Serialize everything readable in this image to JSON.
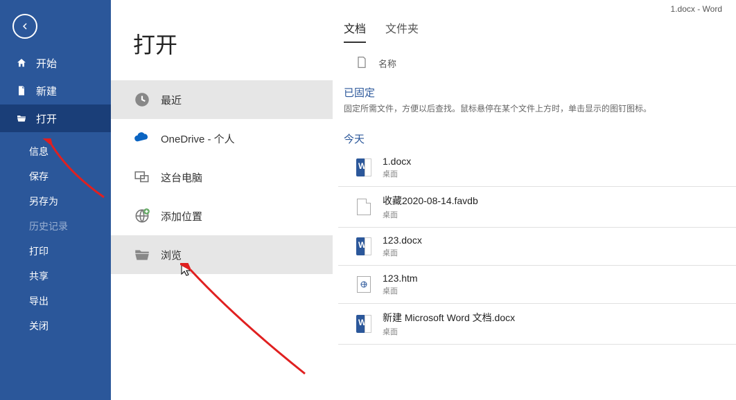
{
  "titlebar": "1.docx  -  Word",
  "sidebar": {
    "items": [
      {
        "label": "开始"
      },
      {
        "label": "新建"
      },
      {
        "label": "打开"
      },
      {
        "label": "信息"
      },
      {
        "label": "保存"
      },
      {
        "label": "另存为"
      },
      {
        "label": "历史记录"
      },
      {
        "label": "打印"
      },
      {
        "label": "共享"
      },
      {
        "label": "导出"
      },
      {
        "label": "关闭"
      }
    ]
  },
  "page_title": "打开",
  "locations": {
    "recent": "最近",
    "onedrive": "OneDrive - 个人",
    "onedrive_sub": "",
    "thispc": "这台电脑",
    "addplace": "添加位置",
    "browse": "浏览"
  },
  "tabs": {
    "docs": "文档",
    "folders": "文件夹"
  },
  "name_header": "名称",
  "pinned": {
    "title": "已固定",
    "desc": "固定所需文件，方便以后查找。鼠标悬停在某个文件上方时，单击显示的图钉图标。"
  },
  "today": "今天",
  "files": [
    {
      "name": "1.docx",
      "loc": "桌面",
      "type": "docx"
    },
    {
      "name": "收藏2020-08-14.favdb",
      "loc": "桌面",
      "type": "file"
    },
    {
      "name": "123.docx",
      "loc": "桌面",
      "type": "docx"
    },
    {
      "name": "123.htm",
      "loc": "桌面",
      "type": "htm"
    },
    {
      "name": "新建 Microsoft Word 文档.docx",
      "loc": "桌面",
      "type": "docx"
    }
  ]
}
